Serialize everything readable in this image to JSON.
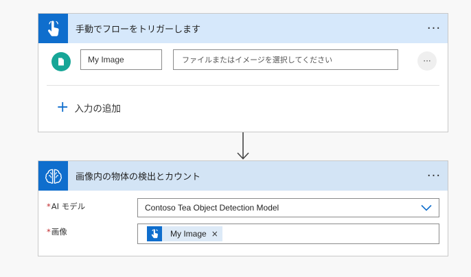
{
  "trigger": {
    "title": "手動でフローをトリガーします",
    "more": "···",
    "input_name": "My Image",
    "file_placeholder": "ファイルまたはイメージを選択してください",
    "row_more": "···",
    "add_plus": "+",
    "add_input_label": "入力の追加",
    "icon": "touch-hand-icon"
  },
  "action": {
    "title": "画像内の物体の検出とカウント",
    "more": "···",
    "icon": "ai-brain-icon",
    "fields": {
      "model_required": "*",
      "model_label": "AI モデル",
      "model_value": "Contoso Tea Object Detection Model",
      "image_required": "*",
      "image_label": "画像",
      "image_token_label": "My Image",
      "image_token_close": "×"
    }
  },
  "colors": {
    "accent": "#0f6ecd",
    "trigger_header_bg": "#d6e8fb",
    "action_header_bg": "#d3e4f5",
    "file_icon_bg": "#16a697",
    "required": "#c0282b"
  }
}
